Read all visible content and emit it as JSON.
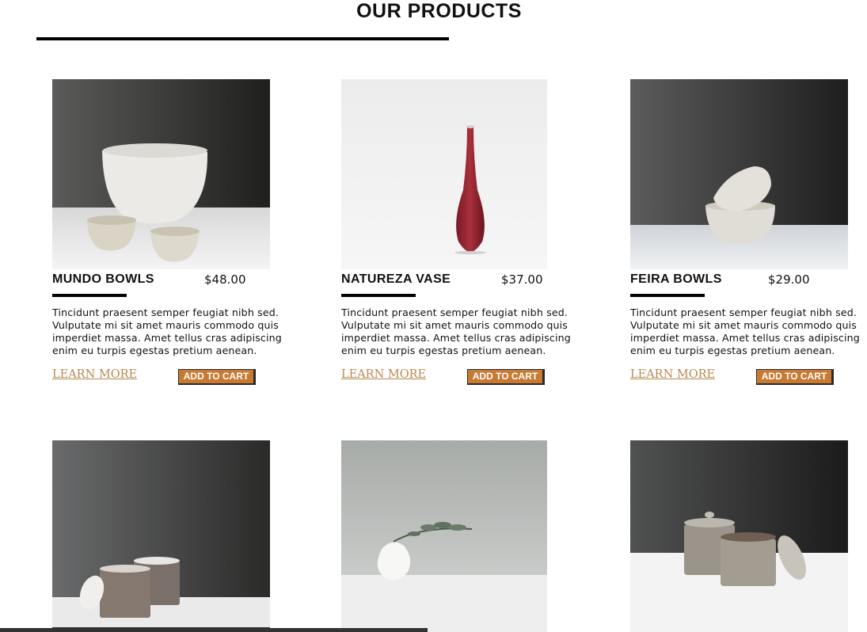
{
  "page": {
    "title": "OUR PRODUCTS"
  },
  "products": [
    {
      "name": "MUNDO BOWLS",
      "price": "$48.00",
      "description": "Tincidunt praesent semper feugiat nibh sed. Vulputate mi sit amet mauris commodo quis imperdiet massa. Amet tellus cras adipiscing enim eu turpis egestas pretium aenean.",
      "learn_more": "LEARN MORE",
      "add_to_cart": "ADD TO CART",
      "image": "white-ceramic-bowls-photo"
    },
    {
      "name": "NATUREZA VASE",
      "price": "$37.00",
      "description": "Tincidunt praesent semper feugiat nibh sed. Vulputate mi sit amet mauris commodo quis imperdiet massa. Amet tellus cras adipiscing enim eu turpis egestas pretium aenean.",
      "learn_more": "LEARN MORE",
      "add_to_cart": "ADD TO CART",
      "image": "red-bud-vase-photo"
    },
    {
      "name": "FEIRA BOWLS",
      "price": "$29.00",
      "description": "Tincidunt praesent semper feugiat nibh sed. Vulputate mi sit amet mauris commodo quis imperdiet massa. Amet tellus cras adipiscing enim eu turpis egestas pretium aenean.",
      "learn_more": "LEARN MORE",
      "add_to_cart": "ADD TO CART",
      "image": "stacked-bowls-photo"
    },
    {
      "image": "lidded-canisters-photo"
    },
    {
      "image": "white-vase-eucalyptus-photo"
    },
    {
      "image": "stoneware-jars-photo"
    }
  ],
  "colors": {
    "accent": "#c87a33",
    "link": "#b8894f",
    "rule": "#000000"
  }
}
